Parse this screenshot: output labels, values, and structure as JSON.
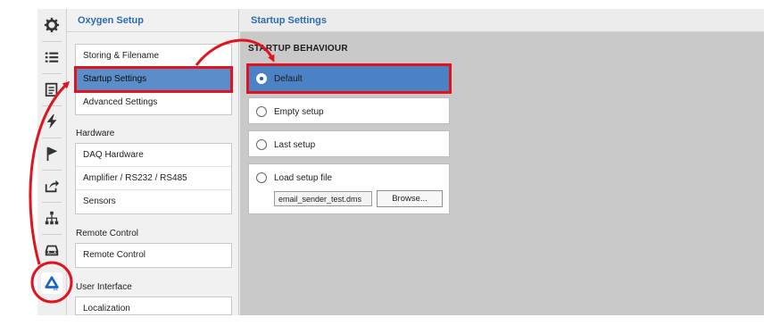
{
  "menu": {
    "header": "Oxygen Setup",
    "group1": [
      "Storing & Filename",
      "Startup Settings",
      "Advanced Settings"
    ],
    "hardware_label": "Hardware",
    "hardware_items": [
      "DAQ Hardware",
      "Amplifier / RS232 / RS485",
      "Sensors"
    ],
    "remote_label": "Remote Control",
    "remote_items": [
      "Remote Control"
    ],
    "ui_label": "User Interface",
    "ui_items": [
      "Localization"
    ]
  },
  "content": {
    "header": "Startup Settings",
    "section_title": "STARTUP BEHAVIOUR",
    "options": [
      "Default",
      "Empty setup",
      "Last setup",
      "Load setup file"
    ],
    "selected_option": "Default",
    "setup_file_value": "email_sender_test.dms",
    "browse_label": "Browse..."
  },
  "rail_icons": [
    "gear-icon",
    "list-icon",
    "document-icon",
    "lightning-icon",
    "flag-icon",
    "export-icon",
    "network-icon",
    "car-icon",
    "oxygen-logo-icon"
  ],
  "colors": {
    "accent": "#2e6cb0",
    "selection": "#4a82c3",
    "highlight_annotation": "#e0141e"
  }
}
